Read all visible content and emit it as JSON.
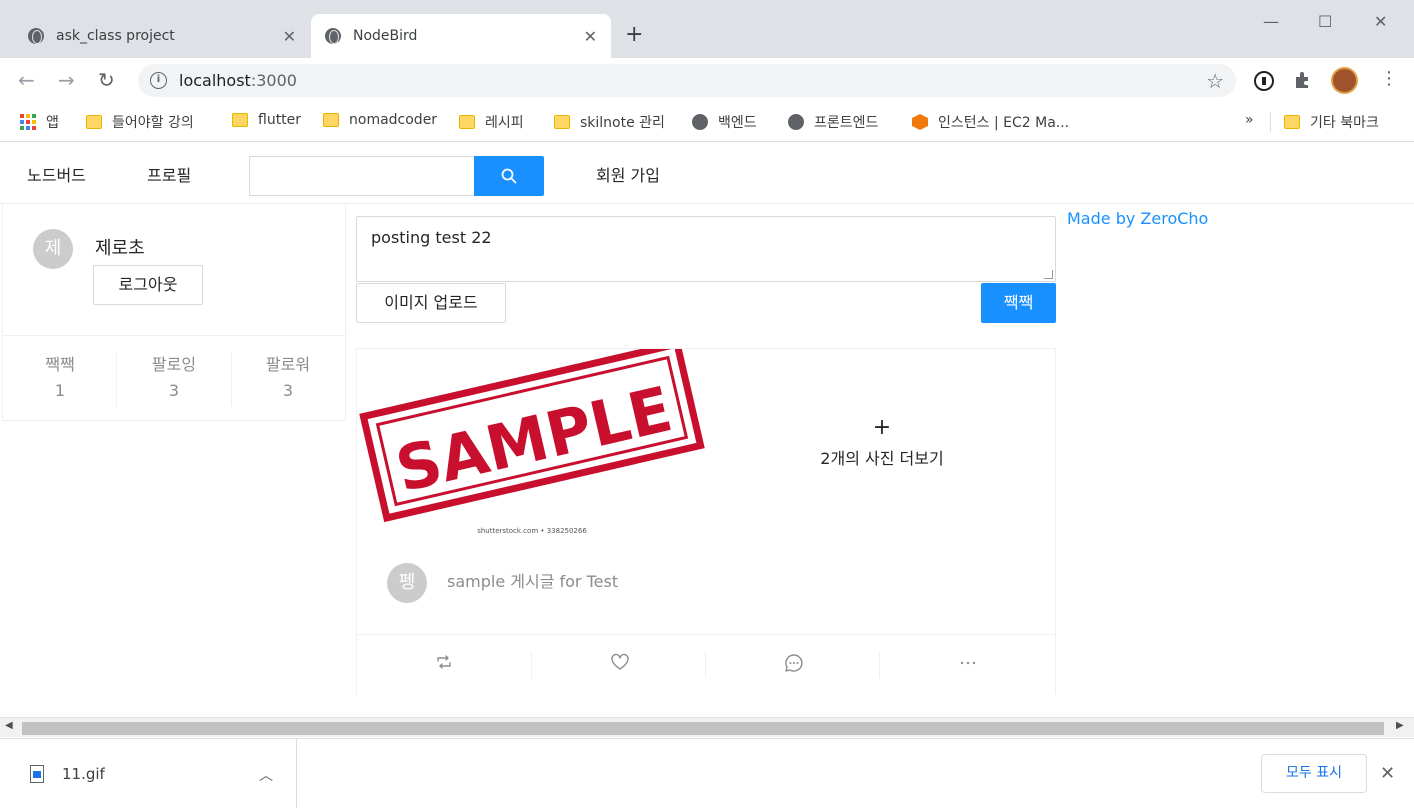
{
  "browser": {
    "tabs": [
      {
        "title": "ask_class project",
        "active": false
      },
      {
        "title": "NodeBird",
        "active": true
      }
    ],
    "new_tab": "+",
    "url_host": "localhost",
    "url_port": ":3000",
    "bookmarks": [
      {
        "label": "앱",
        "icon": "apps-icon"
      },
      {
        "label": "들어야할 강의",
        "icon": "folder-icon"
      },
      {
        "label": "flutter",
        "icon": "folder-icon"
      },
      {
        "label": "nomadcoder",
        "icon": "folder-icon"
      },
      {
        "label": "레시피",
        "icon": "folder-icon"
      },
      {
        "label": "skilnote 관리",
        "icon": "folder-icon"
      },
      {
        "label": "백엔드",
        "icon": "globe-icon"
      },
      {
        "label": "프론트엔드",
        "icon": "globe-icon"
      },
      {
        "label": "인스턴스 | EC2 Ma...",
        "icon": "aws-icon"
      }
    ],
    "bookmarks_overflow": "»",
    "other_bookmarks": "기타 북마크"
  },
  "app": {
    "menu": {
      "home": "노드버드",
      "profile": "프로필",
      "signup": "회원 가입",
      "search_value": ""
    },
    "profile_card": {
      "avatar_initial": "제",
      "nickname": "제로초",
      "logout_label": "로그아웃",
      "stats": [
        {
          "label": "짹짹",
          "value": "1"
        },
        {
          "label": "팔로잉",
          "value": "3"
        },
        {
          "label": "팔로워",
          "value": "3"
        }
      ]
    },
    "post_form": {
      "text": "posting test 22",
      "upload_label": "이미지 업로드",
      "submit_label": "짹짹"
    },
    "made_by": "Made by ZeroCho",
    "post": {
      "image_text": "SAMPLE",
      "image_caption": "shutterstock.com • 338250266",
      "more_photos_plus": "+",
      "more_photos_label": "2개의 사진 더보기",
      "author_initial": "펭",
      "content": "sample 게시글 for Test",
      "actions": [
        "retweet-icon",
        "heart-icon",
        "message-icon",
        "ellipsis-icon"
      ]
    }
  },
  "downloads": {
    "file_name": "11.gif",
    "show_all": "모두 표시"
  },
  "colors": {
    "accent": "#1890ff",
    "stamp_red": "#c8102e"
  }
}
